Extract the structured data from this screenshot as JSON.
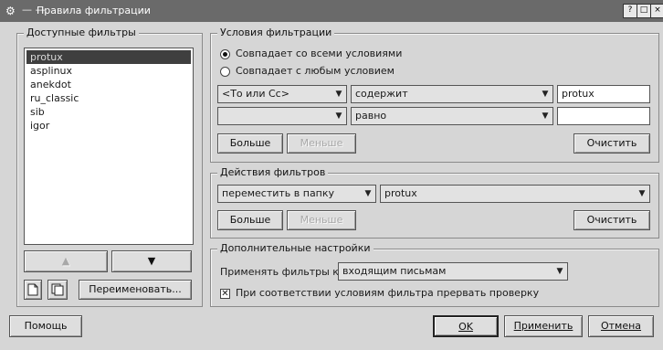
{
  "window": {
    "title": "Правила фильтрации",
    "title_sep": "— —",
    "app_icon": "gear-icon",
    "controls": [
      "?",
      "□",
      "×"
    ]
  },
  "available": {
    "legend": "Доступные фильтры",
    "items": [
      "protux",
      "asplinux",
      "anekdot",
      "ru_classic",
      "sib",
      "igor"
    ],
    "selected_index": 0,
    "up_icon": "arrow-up-icon",
    "down_icon": "arrow-down-icon",
    "new_icon": "new-document-icon",
    "copy_icon": "copy-document-icon",
    "rename_label": "Переименовать..."
  },
  "conditions": {
    "legend": "Условия фильтрации",
    "match_all": "Совпадает со всеми условиями",
    "match_any": "Совпадает с любым условием",
    "selected": "all",
    "rows": [
      {
        "field": "<То или Сс>",
        "op": "содержит",
        "value": "protux"
      },
      {
        "field": "",
        "op": "равно",
        "value": ""
      }
    ],
    "more_label": "Больше",
    "less_label": "Меньше",
    "clear_label": "Очистить"
  },
  "actions": {
    "legend": "Действия фильтров",
    "action": "переместить в папку",
    "target": "protux",
    "more_label": "Больше",
    "less_label": "Меньше",
    "clear_label": "Очистить"
  },
  "extra": {
    "legend": "Дополнительные настройки",
    "apply_to_label": "Применять фильтры к",
    "apply_to_value": "входящим письмам",
    "stop_label": "При соответствии условиям фильтра прервать проверку",
    "stop_checked": true
  },
  "footer": {
    "help": "Помощь",
    "ok": "OK",
    "apply": "Применить",
    "cancel": "Отмена"
  },
  "colors": {
    "background": "#d6d6d6",
    "titlebar": "#6a6a6a",
    "selection": "#3f3f3f"
  }
}
